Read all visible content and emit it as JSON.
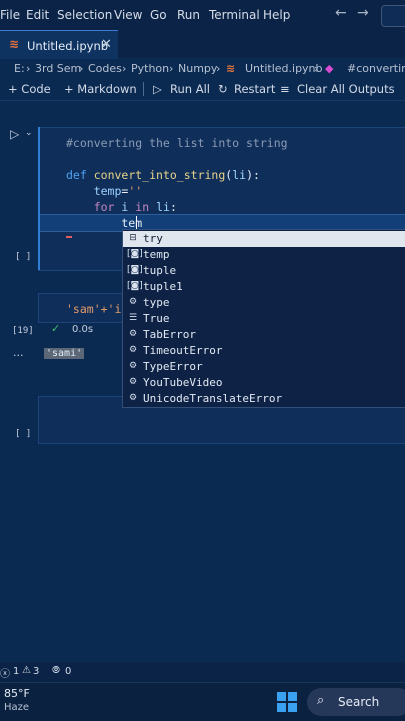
{
  "menubar": {
    "items": [
      "File",
      "Edit",
      "Selection",
      "View",
      "Go",
      "Run",
      "Terminal",
      "Help"
    ],
    "back_arrow": "←",
    "forward_arrow": "→"
  },
  "tab": {
    "label": "Untitled.ipynb",
    "close": "✕",
    "icon": "notebook-icon"
  },
  "breadcrumb": {
    "items": [
      "E:",
      "3rd Sem",
      "Codes",
      "Python",
      "Numpy",
      "Untitled.ipynb",
      "#converting"
    ],
    "separator": "›"
  },
  "toolbar": {
    "code_label": "+ Code",
    "markdown_label": "+ Markdown",
    "run_all_label": "Run All",
    "restart_label": "Restart",
    "clear_outputs_label": "Clear All Outputs"
  },
  "cell1": {
    "exec_count": "[ ]",
    "code_lines": [
      "#converting the list into string",
      "",
      "def convert_into_string(li):",
      "    temp=''",
      "    for i in li:",
      "        tem"
    ]
  },
  "cell2": {
    "code": "'sam'+'i'",
    "exec_count": "[19]",
    "status": "0.0s",
    "more": "...",
    "output": "'sami'"
  },
  "cell3": {
    "exec_count": "[ ]"
  },
  "suggestions": [
    {
      "label": "try",
      "icon": "snippet-icon"
    },
    {
      "label": "temp",
      "icon": "variable-icon"
    },
    {
      "label": "tuple",
      "icon": "variable-icon"
    },
    {
      "label": "tuple1",
      "icon": "variable-icon"
    },
    {
      "label": "type",
      "icon": "class-icon"
    },
    {
      "label": "True",
      "icon": "keyword-icon"
    },
    {
      "label": "TabError",
      "icon": "class-icon"
    },
    {
      "label": "TimeoutError",
      "icon": "class-icon"
    },
    {
      "label": "TypeError",
      "icon": "class-icon"
    },
    {
      "label": "YouTubeVideo",
      "icon": "class-icon"
    },
    {
      "label": "UnicodeTranslateError",
      "icon": "class-icon"
    }
  ],
  "statusbar": {
    "errors": "1",
    "warnings": "3",
    "ports": "0"
  },
  "taskbar": {
    "temperature": "85°F",
    "weather": "Haze",
    "search_label": "Search"
  },
  "colors": {
    "background": "#0b2a52",
    "accent": "#2f7fd8",
    "keyword": "#4fa2f2",
    "comment": "#8a9bb4",
    "string": "#e39a6a",
    "success": "#3fbf6a"
  }
}
